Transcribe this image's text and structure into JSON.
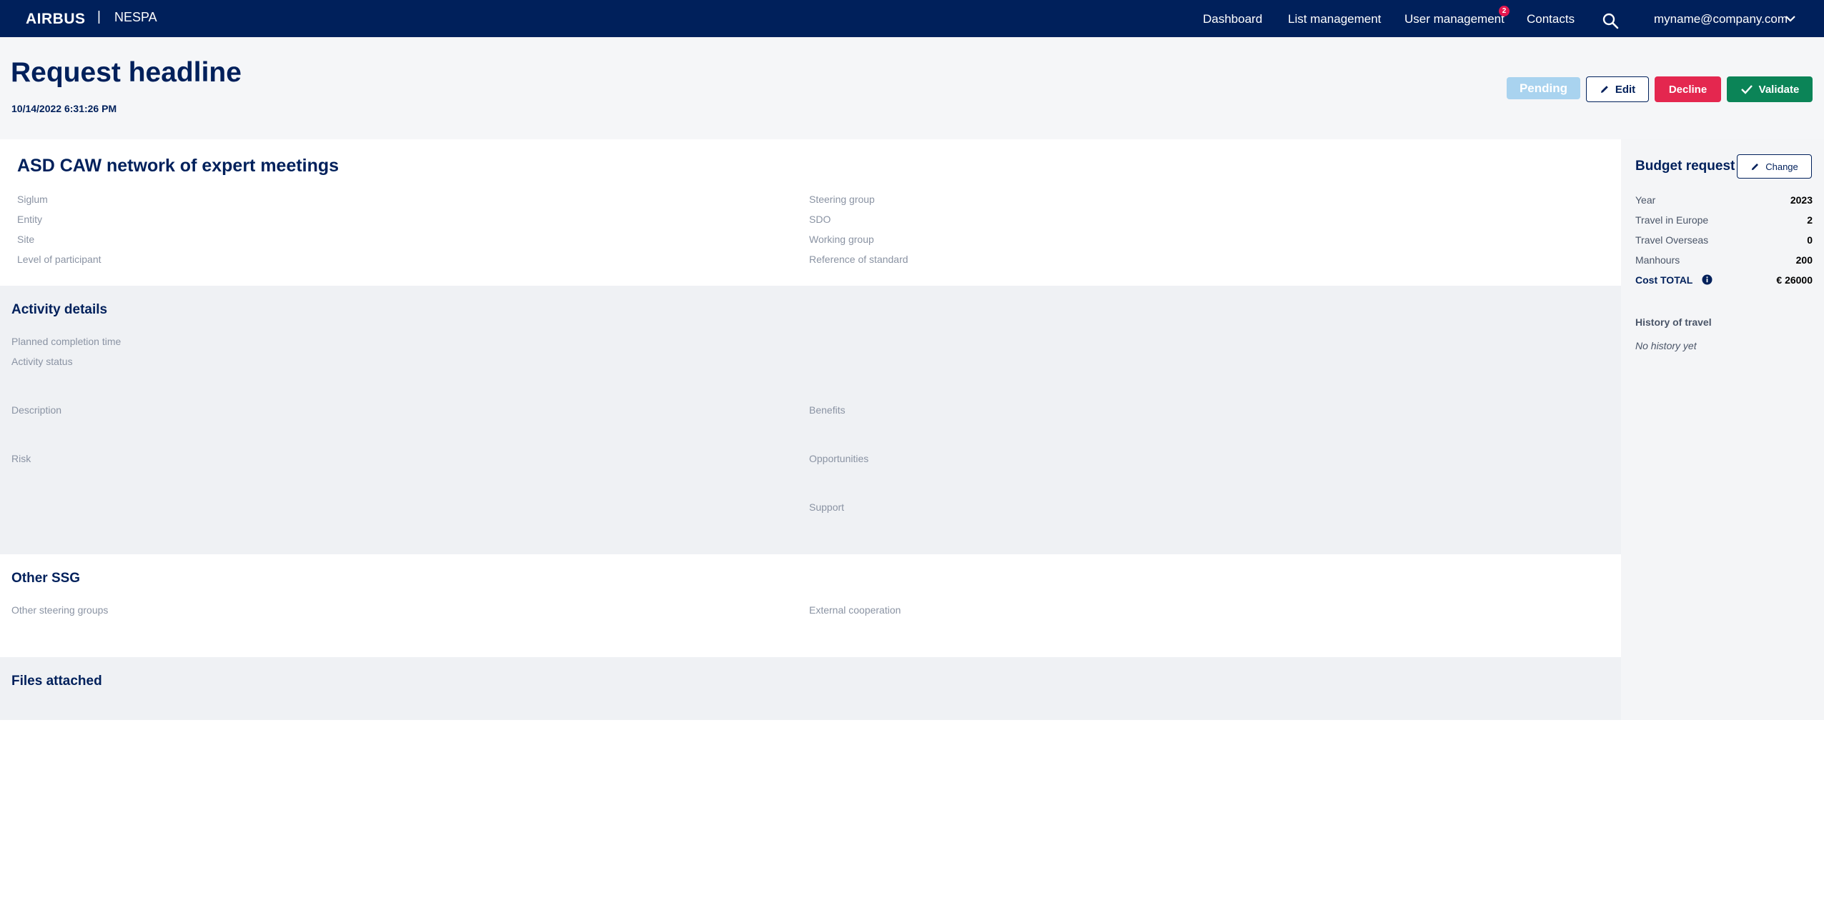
{
  "nav": {
    "brand": "AIRBUS",
    "separator": "|",
    "product": "NESPA",
    "links": [
      "Dashboard",
      "List management",
      "User management",
      "Contacts"
    ],
    "user_management_badge": "2",
    "user_email": "myname@company.com",
    "icons": {
      "search": "search-icon",
      "user_menu": "chevron-down-icon"
    }
  },
  "header": {
    "title": "Request headline",
    "date": "10/14/2022 6:31:26 PM",
    "pending_label": "Pending",
    "edit_label": "Edit",
    "decline_label": "Decline",
    "validate_label": "Validate"
  },
  "general": {
    "title": "ASD CAW network of expert meetings",
    "left_fields": [
      "Siglum",
      "Entity",
      "Site",
      "Level of participant"
    ],
    "right_fields": [
      "Steering group",
      "SDO",
      "Working group",
      "Reference of standard"
    ]
  },
  "activity": {
    "title": "Activity details",
    "planned_completion": "Planned completion time",
    "status": "Activity status",
    "description": "Description",
    "benefits": "Benefits",
    "risk": "Risk",
    "opportunities": "Opportunities",
    "support": "Support"
  },
  "other_ssg": {
    "title": "Other SSG",
    "other_steering": "Other steering groups",
    "external": "External cooperation"
  },
  "files": {
    "title": "Files attached"
  },
  "budget": {
    "title": "Budget request",
    "change_label": "Change",
    "rows": [
      {
        "label": "Year",
        "value": "2023"
      },
      {
        "label": "Travel in Europe",
        "value": "2"
      },
      {
        "label": "Travel Overseas",
        "value": "0"
      },
      {
        "label": "Manhours",
        "value": "200"
      }
    ],
    "total_label": "Cost TOTAL",
    "total_value": "€ 26000",
    "history_title": "History of travel",
    "history_empty": "No history yet"
  },
  "colors": {
    "navy": "#00205b",
    "pending": "#a9d3ef",
    "decline": "#e4274f",
    "validate": "#0b8457",
    "badge": "#e4174f"
  }
}
